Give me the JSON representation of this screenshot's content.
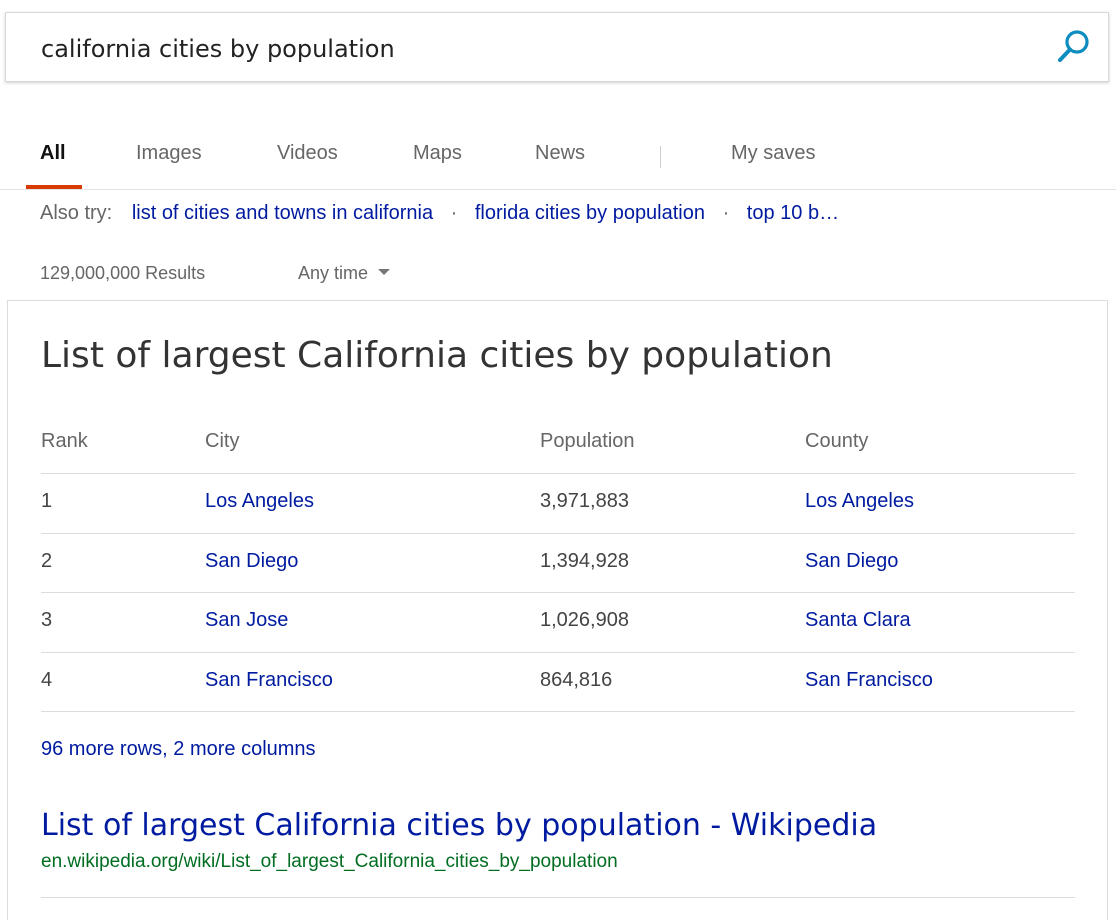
{
  "search": {
    "query": "california cities by population",
    "icon": "search-icon"
  },
  "tabs": [
    {
      "label": "All",
      "active": true
    },
    {
      "label": "Images"
    },
    {
      "label": "Videos"
    },
    {
      "label": "Maps"
    },
    {
      "label": "News"
    },
    {
      "label": "My saves"
    }
  ],
  "also_try": {
    "label": "Also try:",
    "items": [
      "list of cities and towns in california",
      "florida cities by population",
      "top 10 b…"
    ],
    "separator": "·"
  },
  "results_meta": {
    "count": "129,000,000 Results",
    "filter": "Any time"
  },
  "answer": {
    "title": "List of largest California cities by population",
    "columns": [
      "Rank",
      "City",
      "Population",
      "County"
    ],
    "rows": [
      {
        "rank": "1",
        "city": "Los Angeles",
        "population": "3,971,883",
        "county": "Los Angeles"
      },
      {
        "rank": "2",
        "city": "San Diego",
        "population": "1,394,928",
        "county": "San Diego"
      },
      {
        "rank": "3",
        "city": "San Jose",
        "population": "1,026,908",
        "county": "Santa Clara"
      },
      {
        "rank": "4",
        "city": "San Francisco",
        "population": "864,816",
        "county": "San Francisco"
      }
    ],
    "more": "96 more rows, 2 more columns"
  },
  "result": {
    "title": "List of largest California cities by population - Wikipedia",
    "url": "en.wikipedia.org/wiki/List_of_largest_California_cities_by_population"
  },
  "colors": {
    "link": "#001ba0",
    "url": "#006d21",
    "active_tab": "#d83b01",
    "search_icon": "#0c8cbf"
  }
}
